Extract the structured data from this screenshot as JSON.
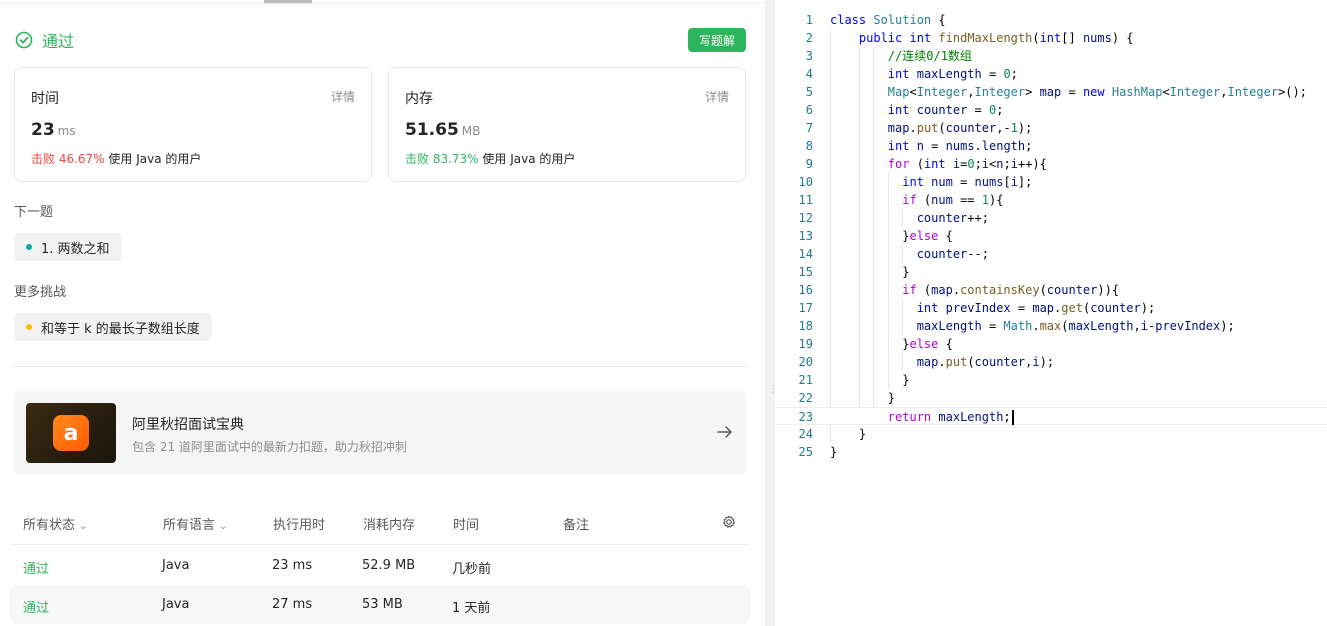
{
  "status": {
    "text": "通过",
    "write_solution": "写题解"
  },
  "time_card": {
    "label": "时间",
    "detail": "详情",
    "value": "23",
    "unit": "ms",
    "beat_pct": "击败 46.67%",
    "beat_suffix": "使用 Java 的用户"
  },
  "memory_card": {
    "label": "内存",
    "detail": "详情",
    "value": "51.65",
    "unit": "MB",
    "beat_pct": "击败 83.73%",
    "beat_suffix": "使用 Java 的用户"
  },
  "next": {
    "label": "下一题",
    "problem": "1. 两数之和"
  },
  "more": {
    "label": "更多挑战",
    "problem": "和等于 k 的最长子数组长度"
  },
  "promo": {
    "title": "阿里秋招面试宝典",
    "subtitle": "包含 21 道阿里面试中的最新力扣题，助力秋招冲刺"
  },
  "submissions": {
    "headers": {
      "status": "所有状态",
      "language": "所有语言",
      "runtime": "执行用时",
      "memory": "消耗内存",
      "time": "时间",
      "note": "备注"
    },
    "rows": [
      {
        "status": "通过",
        "language": "Java",
        "runtime": "23 ms",
        "memory": "52.9 MB",
        "time": "几秒前"
      },
      {
        "status": "通过",
        "language": "Java",
        "runtime": "27 ms",
        "memory": "53 MB",
        "time": "1 天前"
      }
    ]
  },
  "editor": {
    "line_numbers": [
      "1",
      "2",
      "3",
      "4",
      "5",
      "6",
      "7",
      "8",
      "9",
      "10",
      "11",
      "12",
      "13",
      "14",
      "15",
      "16",
      "17",
      "18",
      "19",
      "20",
      "21",
      "22",
      "23",
      "24",
      "25"
    ],
    "active_line": 23
  },
  "colors": {
    "accent_green": "#2db55d",
    "beat_red": "#ef4743",
    "line_number": "#237893"
  }
}
